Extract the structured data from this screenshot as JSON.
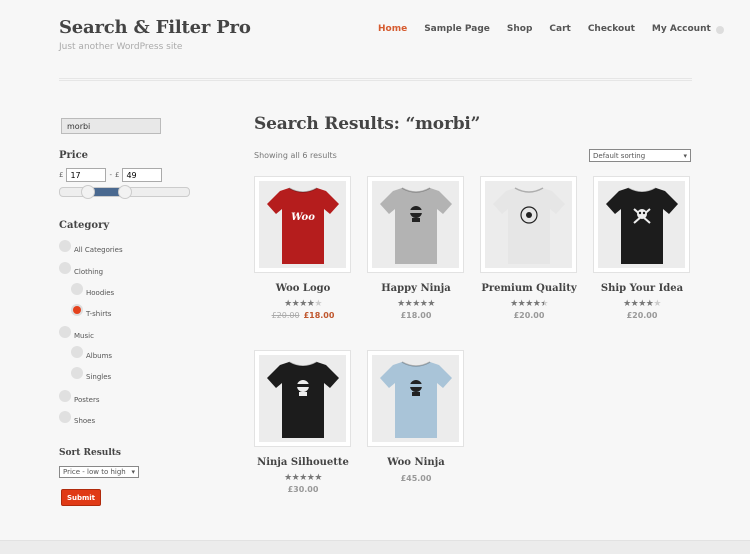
{
  "site": {
    "title": "Search & Filter Pro",
    "tagline": "Just another WordPress site"
  },
  "nav": [
    {
      "label": "Home",
      "active": true
    },
    {
      "label": "Sample Page"
    },
    {
      "label": "Shop"
    },
    {
      "label": "Cart"
    },
    {
      "label": "Checkout"
    },
    {
      "label": "My Account"
    }
  ],
  "sidebar": {
    "search_value": "morbi",
    "price": {
      "heading": "Price",
      "currency": "£",
      "min": "17",
      "separator": "-",
      "max": "49",
      "slider_min_fraction": 0.22,
      "slider_max_fraction": 0.5
    },
    "category": {
      "heading": "Category",
      "items": [
        {
          "label": "All Categories",
          "level": 0
        },
        {
          "label": "Clothing",
          "level": 0
        },
        {
          "label": "Hoodies",
          "level": 1
        },
        {
          "label": "T-shirts",
          "level": 1,
          "selected": true
        },
        {
          "label": "Music",
          "level": 0
        },
        {
          "label": "Albums",
          "level": 1
        },
        {
          "label": "Singles",
          "level": 1
        },
        {
          "label": "Posters",
          "level": 0
        },
        {
          "label": "Shoes",
          "level": 0
        }
      ]
    },
    "sort": {
      "heading": "Sort Results",
      "selected": "Price - low to high"
    },
    "submit_label": "Submit"
  },
  "main": {
    "title": "Search Results: “morbi”",
    "count": "Showing all 6 results",
    "orderby": "Default sorting",
    "products": [
      {
        "name": "Woo Logo",
        "rating": 4,
        "old_price": "£20.00",
        "price": "£18.00",
        "shirt_color": "#b51d1d",
        "print": "Woo"
      },
      {
        "name": "Happy Ninja",
        "rating": 5,
        "price": "£18.00",
        "shirt_color": "#b3b3b3",
        "print": "ninja"
      },
      {
        "name": "Premium Quality",
        "rating": 4.5,
        "price": "£20.00",
        "shirt_color": "#e6e6e6",
        "print": "premium"
      },
      {
        "name": "Ship Your Idea",
        "rating": 4,
        "price": "£20.00",
        "shirt_color": "#1c1c1c",
        "print": "skull"
      },
      {
        "name": "Ninja Silhouette",
        "rating": 5,
        "price": "£30.00",
        "shirt_color": "#1c1c1c",
        "print": "ninja"
      },
      {
        "name": "Woo Ninja",
        "rating": 0,
        "price": "£45.00",
        "shirt_color": "#a9c4d8",
        "print": "ninja"
      }
    ]
  },
  "colors": {
    "accent": "#d65c30",
    "submit": "#e03a16",
    "slider_range": "#4a6990"
  }
}
